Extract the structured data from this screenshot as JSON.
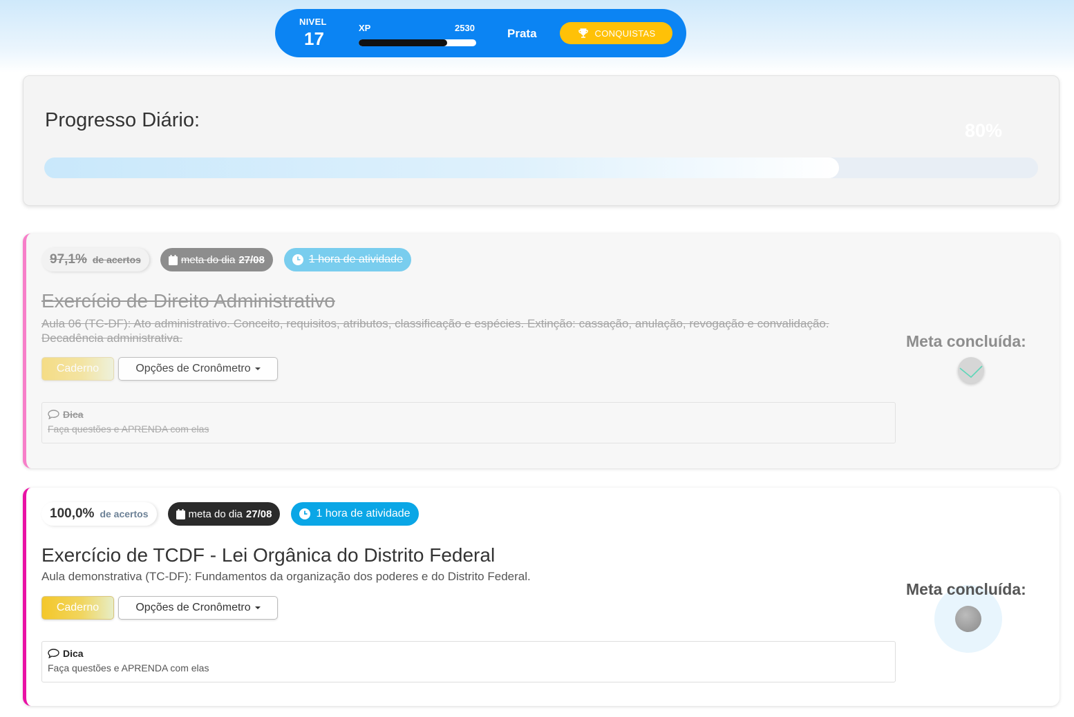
{
  "header": {
    "level_label": "NIVEL",
    "level_value": "17",
    "xp_label": "XP",
    "xp_value": "2530",
    "xp_progress_fraction": 0.75,
    "tier": "Prata",
    "achievements_label": "CONQUISTAS",
    "achievements_icon": "trophy-icon"
  },
  "daily_progress": {
    "title": "Progresso Diário:",
    "percent_label": "80%",
    "percent_value": 80
  },
  "tasks": [
    {
      "status": "completed",
      "score_pct": "97,1%",
      "score_label": "de acertos",
      "date_prefix": "meta do dia",
      "date": "27/08",
      "duration": "1 hora de atividade",
      "title": "Exercício de Direito Administrativo",
      "description": "Aula 06 (TC-DF): Ato administrativo. Conceito, requisitos, atributos, classificação e espécies. Extinção: cassação, anulação, revogação e convalidação. Decadência administrativa.",
      "notebook_label": "Caderno",
      "timer_label": "Opções de Cronômetro",
      "tip_title": "Dica",
      "tip_text": "Faça questões e APRENDA com elas",
      "goal_label": "Meta concluída:",
      "goal_done": true
    },
    {
      "status": "active",
      "score_pct": "100,0%",
      "score_label": "de acertos",
      "date_prefix": "meta do dia",
      "date": "27/08",
      "duration": "1 hora de atividade",
      "title": "Exercício de TCDF - Lei Orgânica do Distrito Federal",
      "description": "Aula demonstrativa (TC-DF): Fundamentos da organização dos poderes e do Distrito Federal.",
      "notebook_label": "Caderno",
      "timer_label": "Opções de Cronômetro",
      "tip_title": "Dica",
      "tip_text": "Faça questões e APRENDA com elas",
      "goal_label": "Meta concluída:",
      "goal_done": false
    }
  ],
  "colors": {
    "topbar": "#0b84f3",
    "achievements": "#ffc107",
    "done_border": "#f77fc9",
    "active_border": "#e912a5",
    "duration_pill": "#0aa6e6"
  }
}
